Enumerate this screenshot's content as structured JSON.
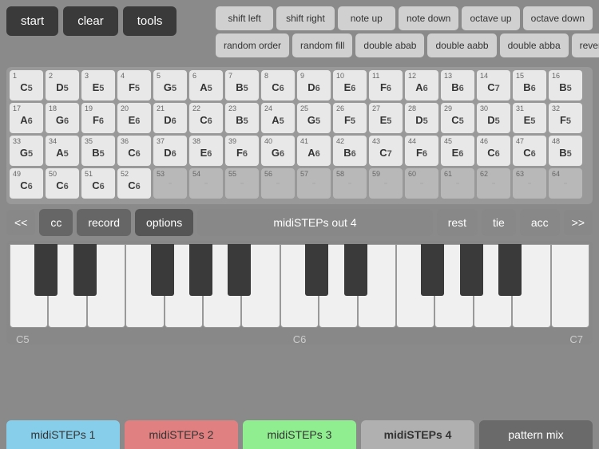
{
  "toolbar": {
    "start_label": "start",
    "clear_label": "clear",
    "tools_label": "tools"
  },
  "right_toolbar": {
    "row1": [
      {
        "label": "shift left",
        "key": "shift-left"
      },
      {
        "label": "shift right",
        "key": "shift-right"
      },
      {
        "label": "note up",
        "key": "note-up"
      },
      {
        "label": "note down",
        "key": "note-down"
      },
      {
        "label": "octave up",
        "key": "octave-up"
      },
      {
        "label": "octave down",
        "key": "octave-down"
      }
    ],
    "row2": [
      {
        "label": "random order",
        "key": "random-order"
      },
      {
        "label": "random fill",
        "key": "random-fill"
      },
      {
        "label": "double abab",
        "key": "double-abab"
      },
      {
        "label": "double aabb",
        "key": "double-aabb"
      },
      {
        "label": "double abba",
        "key": "double-abba"
      },
      {
        "label": "reverse",
        "key": "reverse"
      }
    ]
  },
  "steps": {
    "row1": [
      {
        "num": 1,
        "note": "C",
        "octave": 5,
        "display": "C5"
      },
      {
        "num": 2,
        "note": "D",
        "octave": 5,
        "display": "D5"
      },
      {
        "num": 3,
        "note": "E",
        "octave": 5,
        "display": "E5"
      },
      {
        "num": 4,
        "note": "F",
        "octave": 5,
        "display": "F5"
      },
      {
        "num": 5,
        "note": "G",
        "octave": 5,
        "display": "G5"
      },
      {
        "num": 6,
        "note": "A",
        "octave": 5,
        "display": "A5"
      },
      {
        "num": 7,
        "note": "B",
        "octave": 5,
        "display": "B5"
      },
      {
        "num": 8,
        "note": "C",
        "octave": 6,
        "display": "C6"
      },
      {
        "num": 9,
        "note": "D",
        "octave": 6,
        "display": "D6"
      },
      {
        "num": 10,
        "note": "E",
        "octave": 6,
        "display": "E6"
      },
      {
        "num": 11,
        "note": "F",
        "octave": 6,
        "display": "F6"
      },
      {
        "num": 12,
        "note": "A",
        "octave": 6,
        "display": "A6"
      },
      {
        "num": 13,
        "note": "B",
        "octave": 6,
        "display": "B6"
      },
      {
        "num": 14,
        "note": "C",
        "octave": 7,
        "display": "C7"
      },
      {
        "num": 15,
        "note": "B",
        "octave": 6,
        "display": "B6"
      },
      {
        "num": 16,
        "note": "B",
        "octave": 5,
        "display": "B5"
      }
    ],
    "row2": [
      {
        "num": 17,
        "note": "A",
        "octave": 6,
        "display": "A6"
      },
      {
        "num": 18,
        "note": "G",
        "octave": 6,
        "display": "G6"
      },
      {
        "num": 19,
        "note": "F",
        "octave": 6,
        "display": "F6"
      },
      {
        "num": 20,
        "note": "E",
        "octave": 6,
        "display": "E6"
      },
      {
        "num": 21,
        "note": "D",
        "octave": 6,
        "display": "D6"
      },
      {
        "num": 22,
        "note": "C",
        "octave": 6,
        "display": "C6"
      },
      {
        "num": 23,
        "note": "B",
        "octave": 5,
        "display": "B5"
      },
      {
        "num": 24,
        "note": "A",
        "octave": 5,
        "display": "A5"
      },
      {
        "num": 25,
        "note": "G",
        "octave": 5,
        "display": "G5"
      },
      {
        "num": 26,
        "note": "F",
        "octave": 5,
        "display": "F5"
      },
      {
        "num": 27,
        "note": "E",
        "octave": 5,
        "display": "E5"
      },
      {
        "num": 28,
        "note": "D",
        "octave": 5,
        "display": "D5"
      },
      {
        "num": 29,
        "note": "C",
        "octave": 5,
        "display": "C5"
      },
      {
        "num": 30,
        "note": "D",
        "octave": 5,
        "display": "D5"
      },
      {
        "num": 31,
        "note": "E",
        "octave": 5,
        "display": "E5"
      },
      {
        "num": 32,
        "note": "F",
        "octave": 5,
        "display": "F5"
      }
    ],
    "row3": [
      {
        "num": 33,
        "note": "G",
        "octave": 5,
        "display": "G5"
      },
      {
        "num": 34,
        "note": "A",
        "octave": 5,
        "display": "A5"
      },
      {
        "num": 35,
        "note": "B",
        "octave": 5,
        "display": "B5"
      },
      {
        "num": 36,
        "note": "C",
        "octave": 6,
        "display": "C6"
      },
      {
        "num": 37,
        "note": "D",
        "octave": 6,
        "display": "D6"
      },
      {
        "num": 38,
        "note": "E",
        "octave": 6,
        "display": "E6"
      },
      {
        "num": 39,
        "note": "F",
        "octave": 6,
        "display": "F6"
      },
      {
        "num": 40,
        "note": "G",
        "octave": 6,
        "display": "G6"
      },
      {
        "num": 41,
        "note": "A",
        "octave": 6,
        "display": "A6"
      },
      {
        "num": 42,
        "note": "B",
        "octave": 6,
        "display": "B6"
      },
      {
        "num": 43,
        "note": "C",
        "octave": 7,
        "display": "C7"
      },
      {
        "num": 44,
        "note": "F",
        "octave": 6,
        "display": "F6"
      },
      {
        "num": 45,
        "note": "E",
        "octave": 6,
        "display": "E6"
      },
      {
        "num": 46,
        "note": "C",
        "octave": 6,
        "display": "C6"
      },
      {
        "num": 47,
        "note": "C",
        "octave": 6,
        "display": "C6"
      },
      {
        "num": 48,
        "note": "B",
        "octave": 5,
        "display": "B5"
      }
    ],
    "row4": [
      {
        "num": 49,
        "note": "C",
        "octave": 6,
        "display": "C6"
      },
      {
        "num": 50,
        "note": "C",
        "octave": 6,
        "display": "C6"
      },
      {
        "num": 51,
        "note": "C",
        "octave": 6,
        "display": "C6"
      },
      {
        "num": 52,
        "note": "C",
        "octave": 6,
        "display": "C6"
      },
      {
        "num": 53,
        "empty": true
      },
      {
        "num": 54,
        "empty": true
      },
      {
        "num": 55,
        "empty": true
      },
      {
        "num": 56,
        "empty": true
      },
      {
        "num": 57,
        "empty": true
      },
      {
        "num": 58,
        "empty": true
      },
      {
        "num": 59,
        "empty": true
      },
      {
        "num": 60,
        "empty": true
      },
      {
        "num": 61,
        "empty": true
      },
      {
        "num": 62,
        "empty": true
      },
      {
        "num": 63,
        "empty": true
      },
      {
        "num": 64,
        "empty": true
      }
    ]
  },
  "bottom_toolbar": {
    "prev_label": "<<",
    "next_label": ">>",
    "cc_label": "cc",
    "record_label": "record",
    "options_label": "options",
    "midi_out_label": "midiSTEPs out 4",
    "rest_label": "rest",
    "tie_label": "tie",
    "acc_label": "acc"
  },
  "piano": {
    "label_c5": "C5",
    "label_c6": "C6",
    "label_c7": "C7"
  },
  "tabs": [
    {
      "label": "midiSTEPs 1",
      "key": "tab-1",
      "class": "tab-1"
    },
    {
      "label": "midiSTEPs 2",
      "key": "tab-2",
      "class": "tab-2"
    },
    {
      "label": "midiSTEPs 3",
      "key": "tab-3",
      "class": "tab-3"
    },
    {
      "label": "midiSTEPs 4",
      "key": "tab-4",
      "class": "tab-4"
    },
    {
      "label": "pattern mix",
      "key": "tab-5",
      "class": "tab-5"
    }
  ]
}
